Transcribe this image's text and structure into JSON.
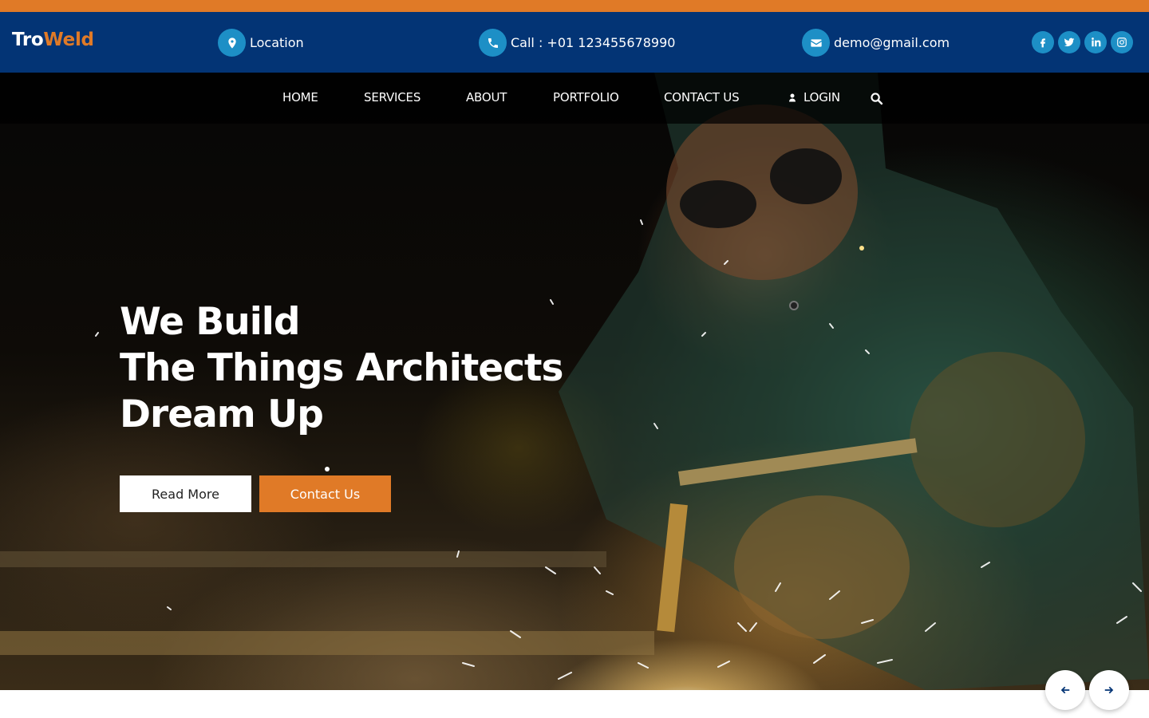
{
  "brand": {
    "part1": "Tro",
    "part2": "Weld"
  },
  "topbar": {
    "location": "Location",
    "phone": "Call : +01 123455678990",
    "email": "demo@gmail.com",
    "social": [
      "facebook-icon",
      "twitter-icon",
      "linkedin-icon",
      "instagram-icon"
    ]
  },
  "nav": {
    "items": [
      "HOME",
      "SERVICES",
      "ABOUT",
      "PORTFOLIO",
      "CONTACT US"
    ],
    "login": "LOGIN",
    "search_icon": "search-icon"
  },
  "hero": {
    "line1": "We Build",
    "line2": "The Things Architects",
    "line3": "Dream Up",
    "read_more": "Read More",
    "contact_us": "Contact Us"
  },
  "colors": {
    "accent": "#e07a27",
    "navy": "#033475",
    "icon_bg": "#1d8fc6"
  }
}
